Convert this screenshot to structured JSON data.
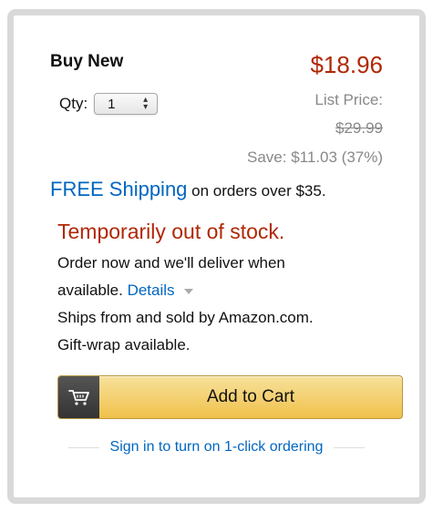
{
  "offer": {
    "title": "Buy New",
    "price": "$18.96",
    "qty_label": "Qty:",
    "qty_value": "1",
    "list_price_label": "List Price:",
    "list_price_value": "$29.99",
    "savings": "Save: $11.03 (37%)"
  },
  "shipping": {
    "free_link": "FREE Shipping",
    "condition": " on orders over $35."
  },
  "availability": {
    "status": "Temporarily out of stock.",
    "line1": "Order now and we'll deliver when",
    "line2_prefix": "available. ",
    "details_link": "Details",
    "ships_from": "Ships from and sold by Amazon.com.",
    "gift_wrap": "Gift-wrap available."
  },
  "cart": {
    "button_label": "Add to Cart",
    "icon": "cart-icon"
  },
  "one_click": {
    "link": "Sign in to turn on 1-click ordering"
  },
  "colors": {
    "price_red": "#b12704",
    "link_blue": "#0066c0",
    "button_yellow": "#f0c14b",
    "muted_gray": "#888888",
    "frame_gray": "#d9d9d9"
  },
  "icons": [
    "cart-icon",
    "select-arrows-icon",
    "caret-down-icon"
  ]
}
